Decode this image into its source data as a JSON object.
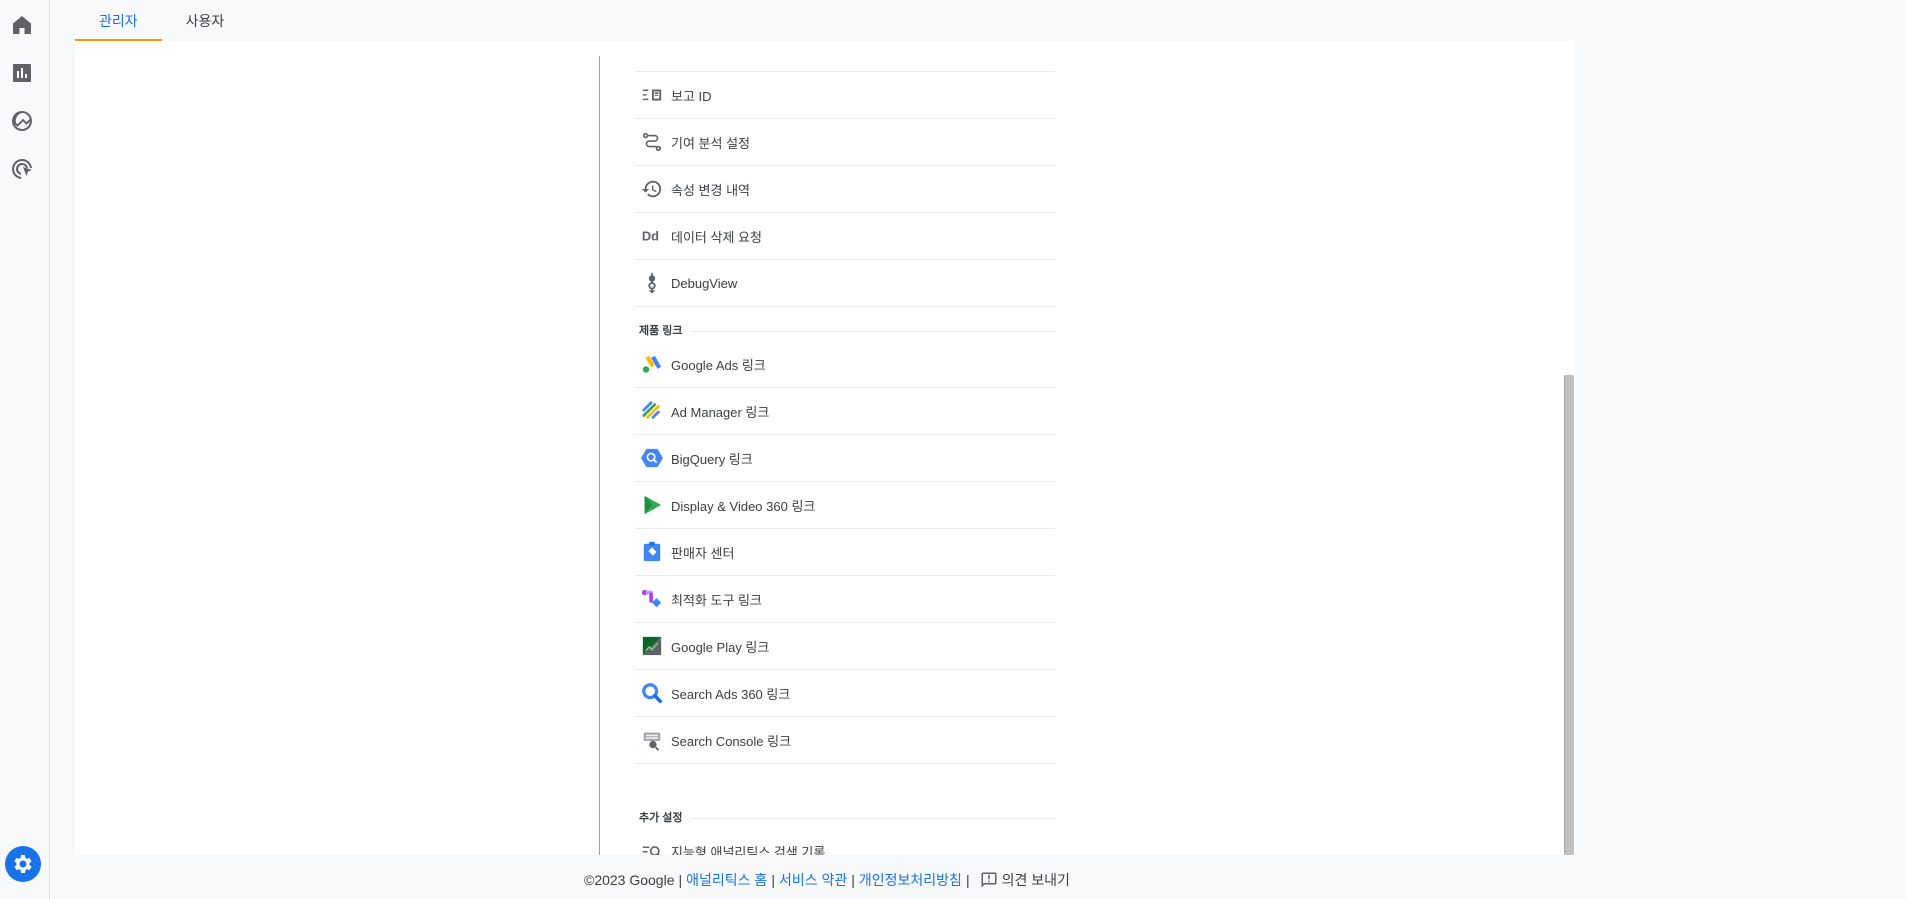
{
  "tabs": [
    {
      "label": "관리자",
      "active": true
    },
    {
      "label": "사용자",
      "active": false
    }
  ],
  "rail": {
    "icons": [
      "home-icon",
      "reports-icon",
      "explore-icon",
      "advertising-icon"
    ],
    "settings_icon": "gear-icon"
  },
  "menu": {
    "property_items": [
      {
        "label": "보고 ID",
        "icon": "reporting-id-icon"
      },
      {
        "label": "기여 분석 설정",
        "icon": "attribution-icon"
      },
      {
        "label": "속성 변경 내역",
        "icon": "history-icon"
      },
      {
        "label": "데이터 삭제 요청",
        "icon": "data-deletion-icon"
      },
      {
        "label": "DebugView",
        "icon": "debugview-icon"
      }
    ],
    "product_links_title": "제품 링크",
    "product_links": [
      {
        "label": "Google Ads 링크",
        "icon": "google-ads-icon"
      },
      {
        "label": "Ad Manager 링크",
        "icon": "ad-manager-icon"
      },
      {
        "label": "BigQuery 링크",
        "icon": "bigquery-icon"
      },
      {
        "label": "Display & Video 360 링크",
        "icon": "dv360-icon"
      },
      {
        "label": "판매자 센터",
        "icon": "merchant-center-icon"
      },
      {
        "label": "최적화 도구 링크",
        "icon": "optimize-icon"
      },
      {
        "label": "Google Play 링크",
        "icon": "google-play-icon"
      },
      {
        "label": "Search Ads 360 링크",
        "icon": "search-ads-360-icon"
      },
      {
        "label": "Search Console 링크",
        "icon": "search-console-icon"
      }
    ],
    "additional_title": "추가 설정",
    "additional_items": [
      {
        "label": "지능형 애널리틱스 검색 기록",
        "icon": "search-history-icon"
      }
    ]
  },
  "footer": {
    "copyright": "©2023 Google",
    "sep": "|",
    "link_home": "애널리틱스 홈",
    "link_terms": "서비스 약관",
    "link_privacy": "개인정보처리방침",
    "feedback": "의견 보내기"
  },
  "colors": {
    "accent": "#1a73e8",
    "tab_indicator": "#f29900"
  }
}
